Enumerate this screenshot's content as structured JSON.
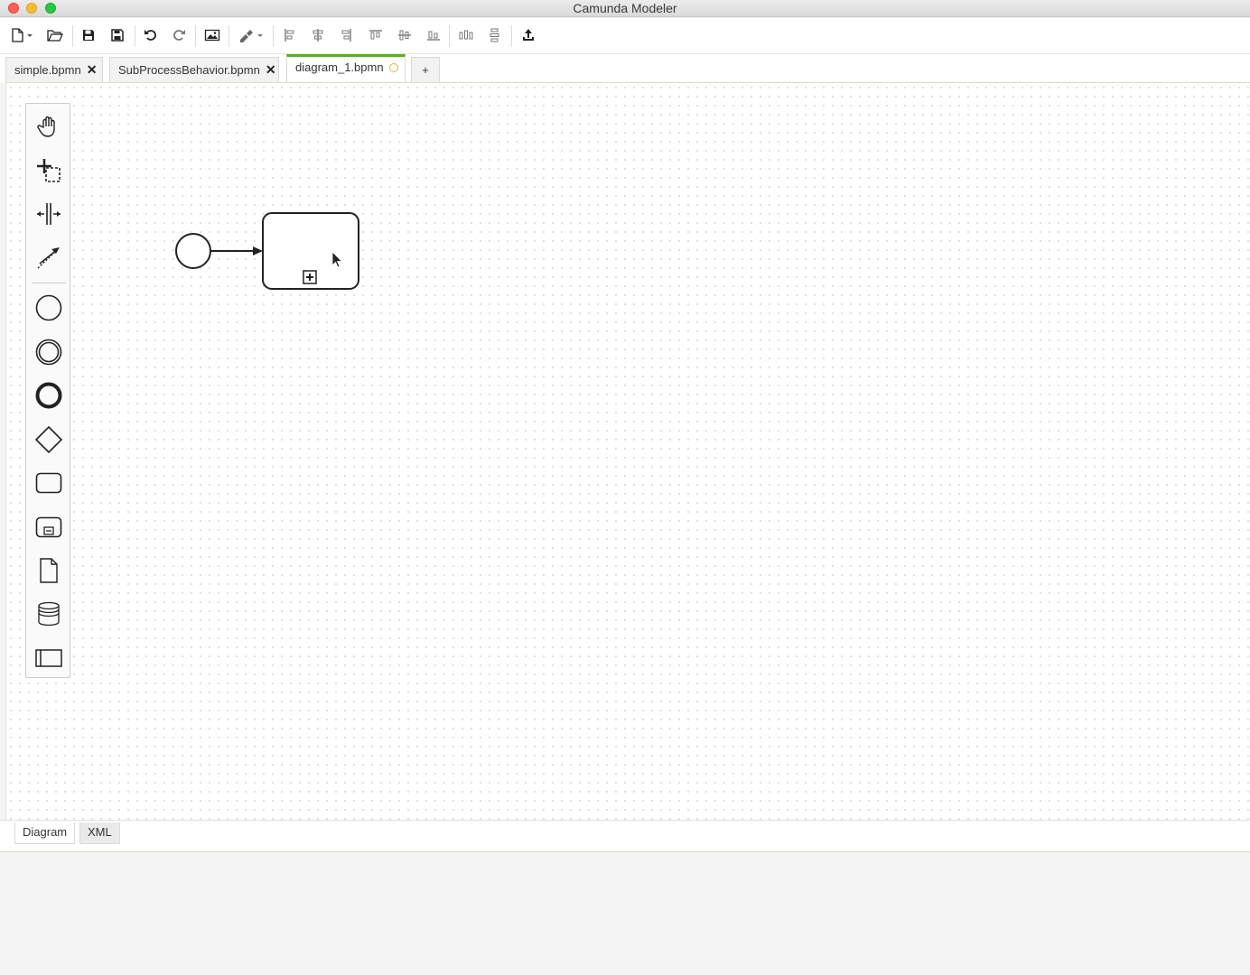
{
  "window": {
    "title": "Camunda Modeler"
  },
  "toolbar": {
    "buttons": [
      {
        "name": "new-file-icon"
      },
      {
        "name": "open-file-icon"
      },
      {
        "name": "save-icon"
      },
      {
        "name": "save-as-icon"
      },
      {
        "name": "undo-icon"
      },
      {
        "name": "redo-icon"
      },
      {
        "name": "export-image-icon"
      },
      {
        "name": "color-picker-icon"
      },
      {
        "name": "align-left-icon"
      },
      {
        "name": "align-center-icon"
      },
      {
        "name": "align-right-icon"
      },
      {
        "name": "align-top-icon"
      },
      {
        "name": "align-middle-icon"
      },
      {
        "name": "align-bottom-icon"
      },
      {
        "name": "distribute-horizontal-icon"
      },
      {
        "name": "distribute-vertical-icon"
      },
      {
        "name": "deploy-icon"
      }
    ]
  },
  "tabs": [
    {
      "label": "simple.bpmn",
      "state": "closable"
    },
    {
      "label": "SubProcessBehavior.bpmn",
      "state": "closable"
    },
    {
      "label": "diagram_1.bpmn",
      "state": "dirty"
    },
    {
      "label": "+"
    }
  ],
  "tab_close_glyph": "✕",
  "palette": {
    "tools": [
      "hand-tool-icon",
      "lasso-tool-icon",
      "space-tool-icon",
      "global-connect-icon"
    ],
    "elements": [
      "start-event-icon",
      "intermediate-event-icon",
      "end-event-icon",
      "gateway-icon",
      "task-icon",
      "subprocess-icon",
      "data-object-icon",
      "data-store-icon",
      "pool-icon"
    ]
  },
  "view_tabs": [
    {
      "label": "Diagram",
      "active": true
    },
    {
      "label": "XML",
      "active": false
    }
  ],
  "colors": {
    "active_tab_accent": "#52b415",
    "dirty_indicator": "#f0b432"
  }
}
